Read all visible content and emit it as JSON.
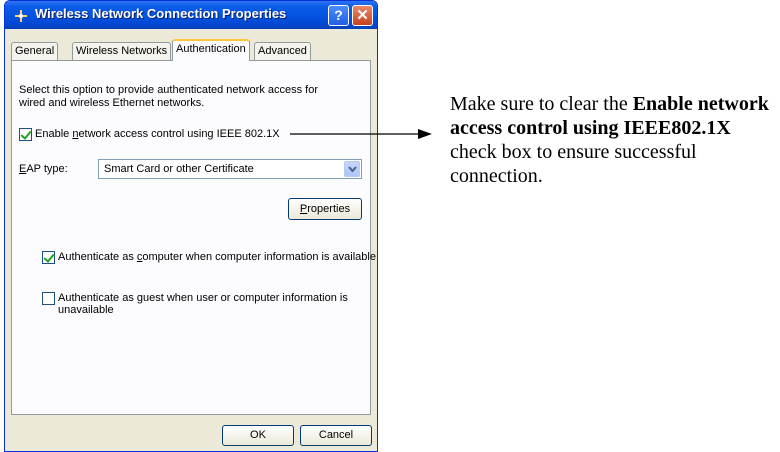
{
  "window": {
    "title": "Wireless Network Connection Properties",
    "help_label": "?",
    "close_label": "✕"
  },
  "tabs": [
    {
      "label": "General"
    },
    {
      "label": "Wireless Networks"
    },
    {
      "label": "Authentication",
      "active": true
    },
    {
      "label": "Advanced"
    }
  ],
  "auth": {
    "description_line1": "Select this option to provide authenticated network access for",
    "description_line2": "wired and wireless Ethernet networks.",
    "enable_8021x": {
      "pre": "Enable ",
      "u": "n",
      "post": "etwork access control using IEEE 802.1X",
      "checked": true
    },
    "eap_type": {
      "u": "E",
      "post": "AP type:",
      "value": "Smart Card or other Certificate"
    },
    "properties_button": {
      "u": "P",
      "post": "roperties"
    },
    "auth_computer": {
      "pre": "Authenticate as ",
      "u": "c",
      "post": "omputer when computer information is available",
      "checked": true
    },
    "auth_guest": {
      "pre": "Authenticate as ",
      "u": "g",
      "post": "uest when user or computer information is",
      "line2": "unavailable",
      "checked": false
    }
  },
  "footer": {
    "ok_label": "OK",
    "cancel_label": "Cancel"
  },
  "annotation": {
    "pre": "Make sure to clear the ",
    "bold": "Enable network access control using IEEE802.1X",
    "post": " check box to ensure successful connection."
  },
  "colors": {
    "titlebar": "#0552e0",
    "active_tab_accent": "#ffc83c",
    "checkmark": "#21a121"
  }
}
